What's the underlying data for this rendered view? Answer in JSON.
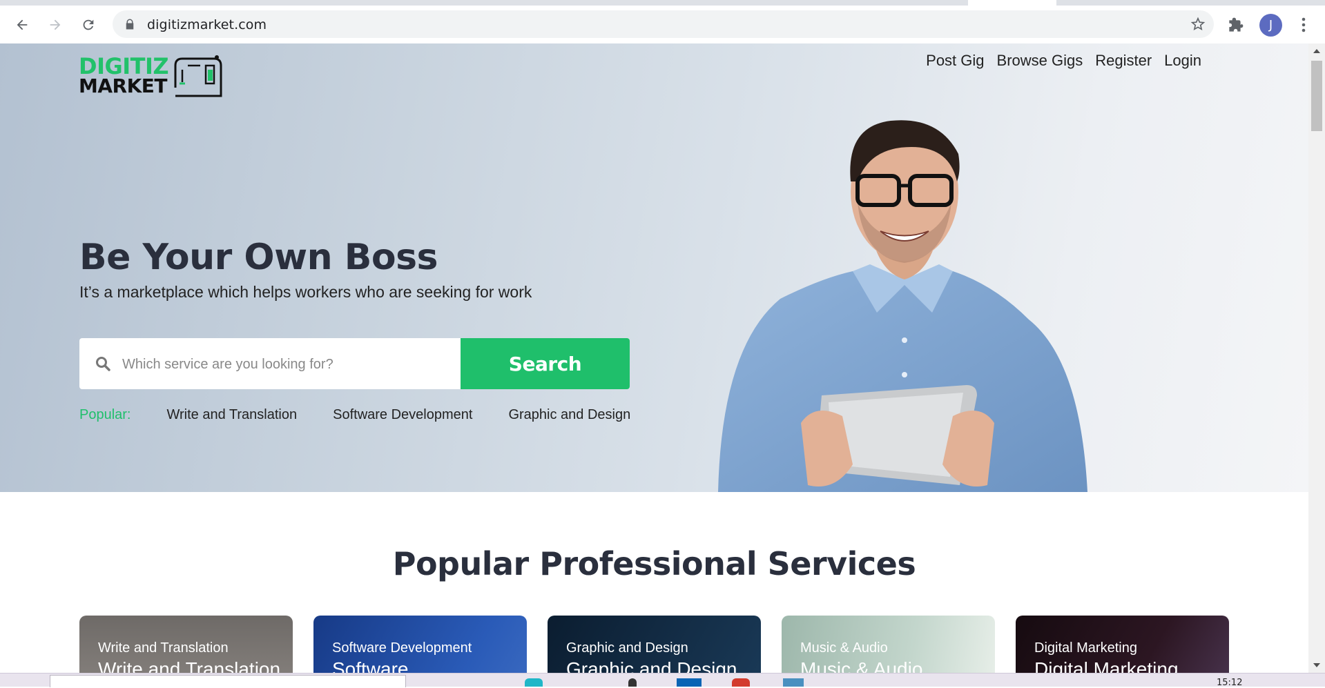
{
  "browser": {
    "url": "digitizmarket.com",
    "profile_initial": "J"
  },
  "site": {
    "logo_line1": "DIGITIZ",
    "logo_line2": "MARKET",
    "nav": [
      "Post Gig",
      "Browse Gigs",
      "Register",
      "Login"
    ]
  },
  "hero": {
    "title": "Be Your Own Boss",
    "subtitle": "It’s a marketplace which helps workers who are seeking for work",
    "search_placeholder": "Which service are you looking for?",
    "search_button": "Search",
    "popular_label": "Popular:",
    "popular_links": [
      "Write and Translation",
      "Software Development",
      "Graphic and Design"
    ]
  },
  "services": {
    "title": "Popular Professional Services",
    "cards": [
      {
        "small": "Write and Translation",
        "big": "Write and Translation",
        "color": "#6e6a67"
      },
      {
        "small": "Software Development",
        "big": "Software",
        "color": "#1f3f8a"
      },
      {
        "small": "Graphic and Design",
        "big": "Graphic and Design",
        "color": "#0f2438"
      },
      {
        "small": "Music & Audio",
        "big": "Music & Audio",
        "color": "#a9c2b6"
      },
      {
        "small": "Digital Marketing",
        "big": "Digital Marketing",
        "color": "#1b0f15"
      }
    ]
  },
  "taskbar": {
    "clock": "15:12"
  },
  "colors": {
    "brand_green": "#1fbf6b",
    "heading": "#2a2f3d"
  }
}
